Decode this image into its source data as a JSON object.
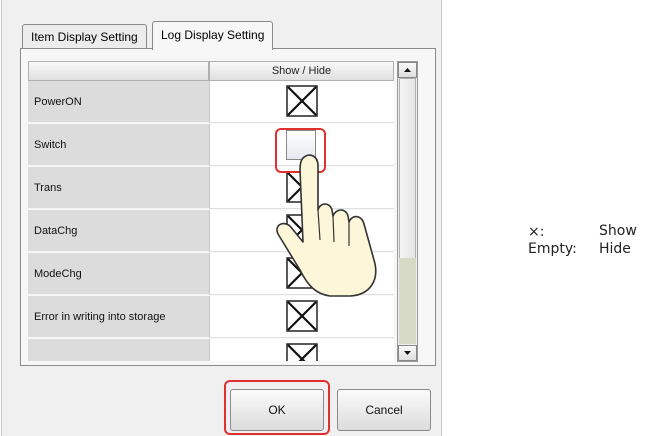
{
  "tabs": [
    {
      "label": "Item Display Setting"
    },
    {
      "label": "Log Display Setting"
    }
  ],
  "table": {
    "column_header": "Show / Hide",
    "rows": [
      {
        "name": "PowerON",
        "state": "show"
      },
      {
        "name": "Switch",
        "state": "hide"
      },
      {
        "name": "Trans",
        "state": "show"
      },
      {
        "name": "DataChg",
        "state": "show"
      },
      {
        "name": "ModeChg",
        "state": "show"
      },
      {
        "name": "Error in writing into storage",
        "state": "show"
      },
      {
        "name": "",
        "state": "show"
      }
    ]
  },
  "buttons": {
    "ok": "OK",
    "cancel": "Cancel"
  },
  "legend": {
    "show_symbol": "×:",
    "show_label": "Show",
    "empty_symbol": "Empty:",
    "empty_label": "Hide"
  },
  "icons": [
    "x-mark-icon",
    "checkbox-icon",
    "hand-pointer-icon",
    "scroll-up-icon",
    "scroll-down-icon"
  ],
  "colors": {
    "highlight": "#e03030"
  }
}
